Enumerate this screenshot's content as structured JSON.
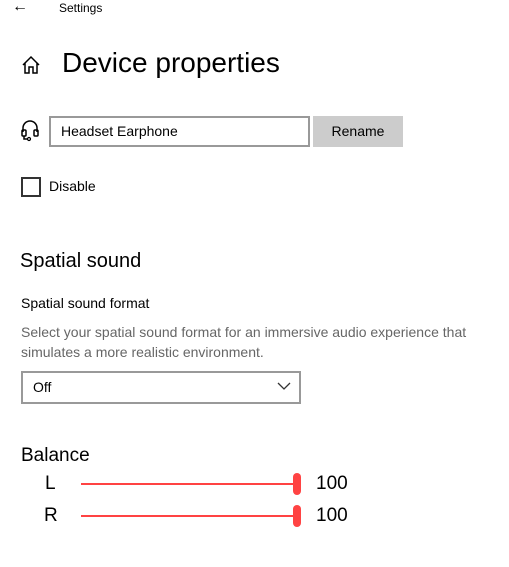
{
  "header": {
    "app_title": "Settings",
    "back_icon": "arrow-left-icon"
  },
  "page": {
    "title": "Device properties",
    "home_icon": "home-icon"
  },
  "device": {
    "icon": "headset-icon",
    "name_value": "Headset Earphone",
    "rename_label": "Rename",
    "disable_label": "Disable",
    "disable_checked": false
  },
  "spatial": {
    "heading": "Spatial sound",
    "format_label": "Spatial sound format",
    "description": "Select your spatial sound format for an immersive audio experience that simulates a more realistic environment.",
    "selected": "Off"
  },
  "balance": {
    "heading": "Balance",
    "channels": [
      {
        "label": "L",
        "value": "100",
        "level": 100
      },
      {
        "label": "R",
        "value": "100",
        "level": 100
      }
    ]
  },
  "colors": {
    "accent": "#ff4343",
    "button_bg": "#cccccc"
  }
}
